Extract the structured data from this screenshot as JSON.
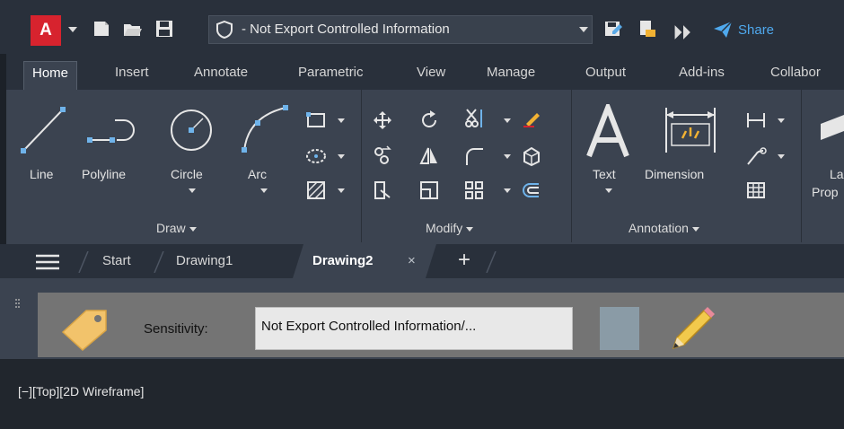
{
  "quick_access": {
    "app_letter": "A",
    "sensitivity_title": "- Not Export Controlled Information",
    "share_label": "Share",
    "icons": [
      "new-icon",
      "open-icon",
      "save-icon",
      "shield-icon",
      "save-as-icon",
      "plot-icon",
      "more-icon",
      "share-icon"
    ]
  },
  "ribbon_tabs": [
    "Home",
    "Insert",
    "Annotate",
    "Parametric",
    "View",
    "Manage",
    "Output",
    "Add-ins",
    "Collabor"
  ],
  "draw_panel": {
    "title": "Draw",
    "tools": [
      "Line",
      "Polyline",
      "Circle",
      "Arc"
    ]
  },
  "modify_panel": {
    "title": "Modify"
  },
  "annotation_panel": {
    "title": "Annotation",
    "tools": [
      "Text",
      "Dimension"
    ]
  },
  "layers_panel": {
    "label_top": "La",
    "label_bottom": "Prop"
  },
  "file_tabs": {
    "items": [
      "Start",
      "Drawing1",
      "Drawing2"
    ],
    "active": "Drawing2",
    "close_glyph": "×",
    "add_glyph": "+"
  },
  "sensitivity_bar": {
    "label": "Sensitivity:",
    "value": "Not Export Controlled Information/..."
  },
  "viewport": {
    "label": "[−][Top][2D Wireframe]"
  },
  "colors": {
    "app_red": "#d7232e",
    "share_blue": "#4fa9ee",
    "ribbon_bg": "#3b4350",
    "swatch": "#8a9ba6"
  }
}
